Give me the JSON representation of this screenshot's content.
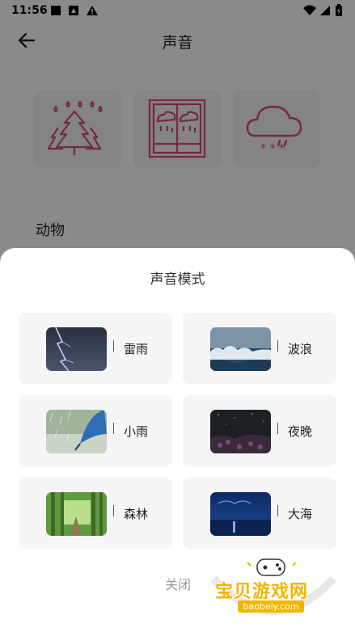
{
  "status": {
    "time": "11:56"
  },
  "toolbar": {
    "title": "声音"
  },
  "section": {
    "title": "动物"
  },
  "sheet": {
    "title": "声音模式",
    "close_label": "关闭",
    "items": [
      {
        "label": "雷雨",
        "icon": "thunderstorm-image"
      },
      {
        "label": "波浪",
        "icon": "waves-image"
      },
      {
        "label": "小雨",
        "icon": "light-rain-image"
      },
      {
        "label": "夜晚",
        "icon": "night-image"
      },
      {
        "label": "森林",
        "icon": "forest-image"
      },
      {
        "label": "大海",
        "icon": "ocean-image"
      }
    ]
  },
  "watermark": {
    "text": "宝贝游戏网",
    "url": "baobeiy.com"
  },
  "colors": {
    "accent_pink": "#d94a7a",
    "watermark_yellow": "#f2b500"
  }
}
